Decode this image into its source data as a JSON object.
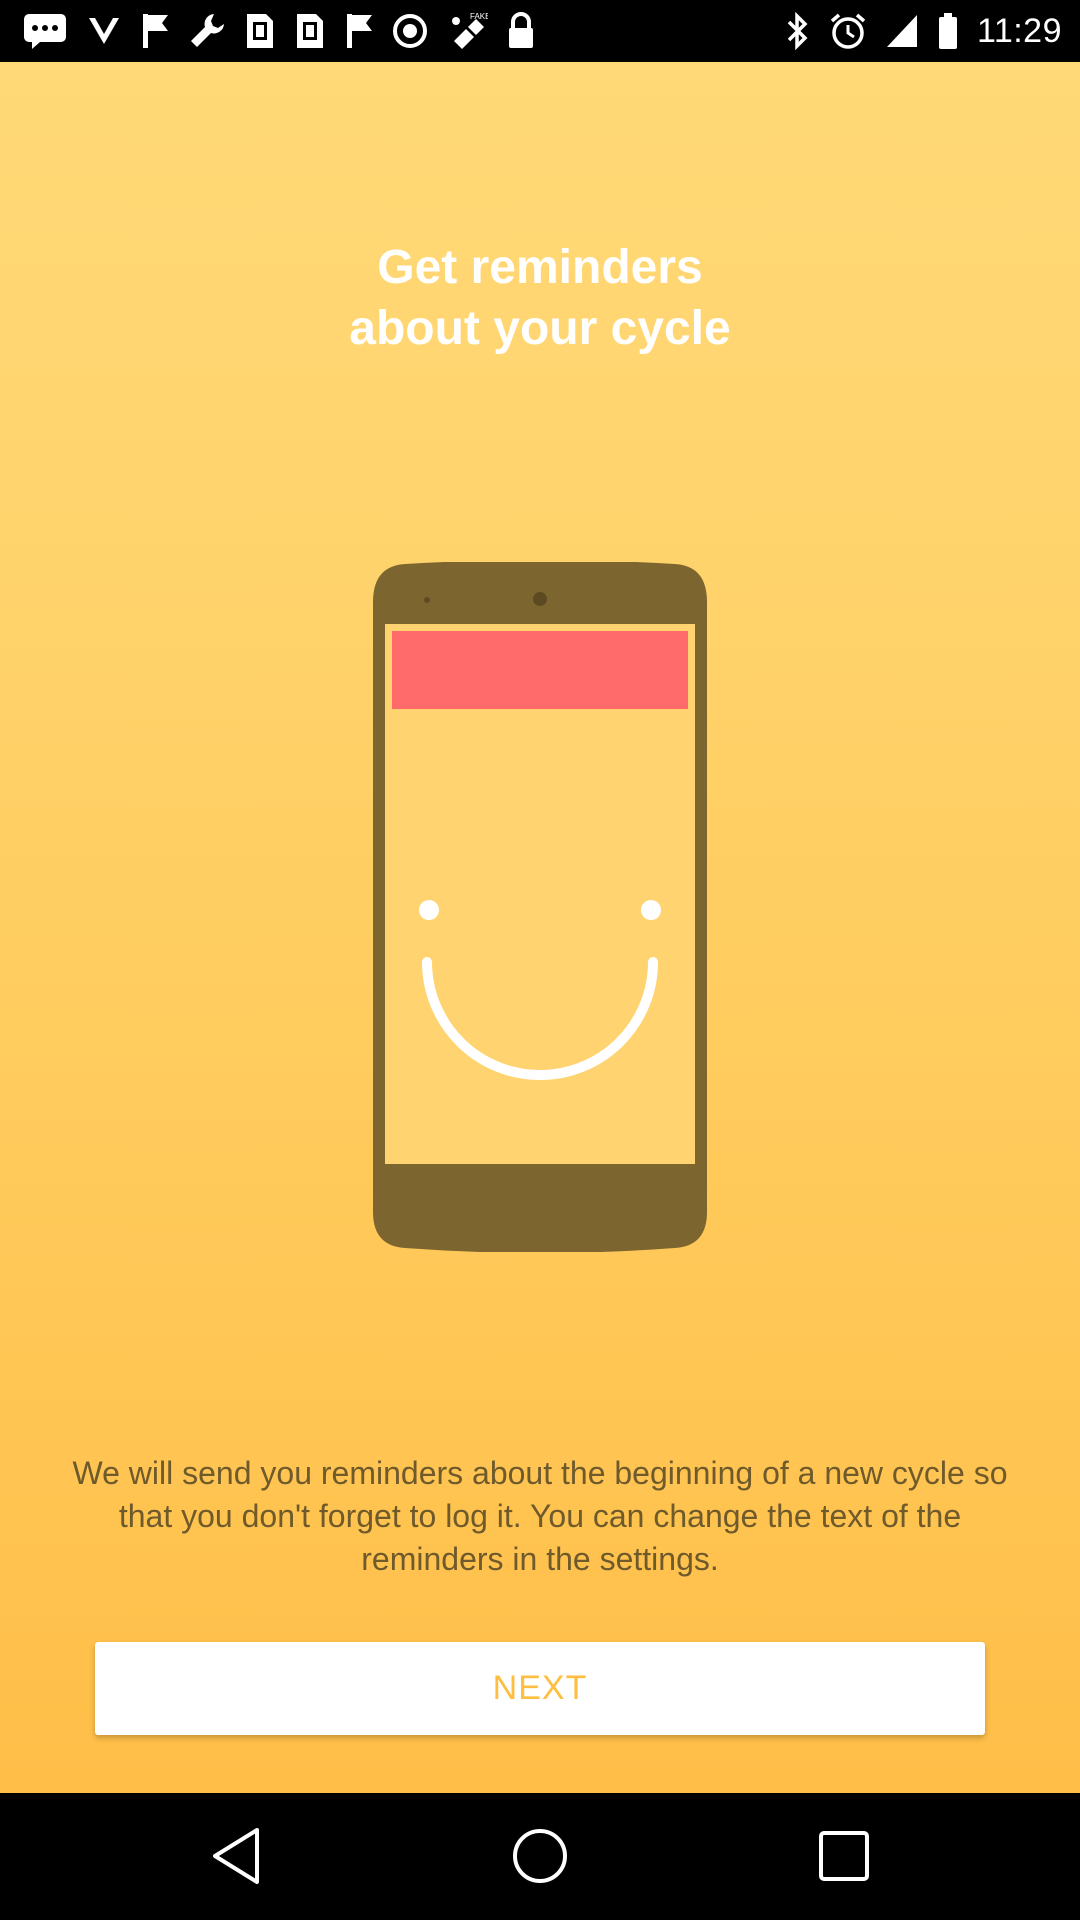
{
  "status_bar": {
    "time": "11:29",
    "left_icons": [
      "message-icon",
      "chevron-down-icon",
      "flag-icon",
      "wrench-icon",
      "sim-toolkit-icon",
      "sim-toolkit-icon",
      "flag-icon",
      "blocked-icon",
      "fake-gps-icon",
      "lock-icon"
    ],
    "right_icons": [
      "bluetooth-icon",
      "alarm-icon",
      "signal-icon",
      "battery-icon"
    ]
  },
  "onboarding": {
    "title_line1": "Get reminders",
    "title_line2": "about your cycle",
    "description": "We will send you reminders about the beginning of a new cycle so that you don't forget to log it. You can change the text of the reminders in the settings.",
    "next_label": "NEXT"
  },
  "colors": {
    "background_top": "#FFD977",
    "background_bottom": "#FFBE48",
    "phone_body": "#7D6530",
    "phone_screen": "#FFD36F",
    "notification_bar": "#FF6B6B",
    "accent_text": "#FFBE3F"
  },
  "nav_bar": {
    "icons": [
      "back-icon",
      "home-icon",
      "recents-icon"
    ]
  }
}
